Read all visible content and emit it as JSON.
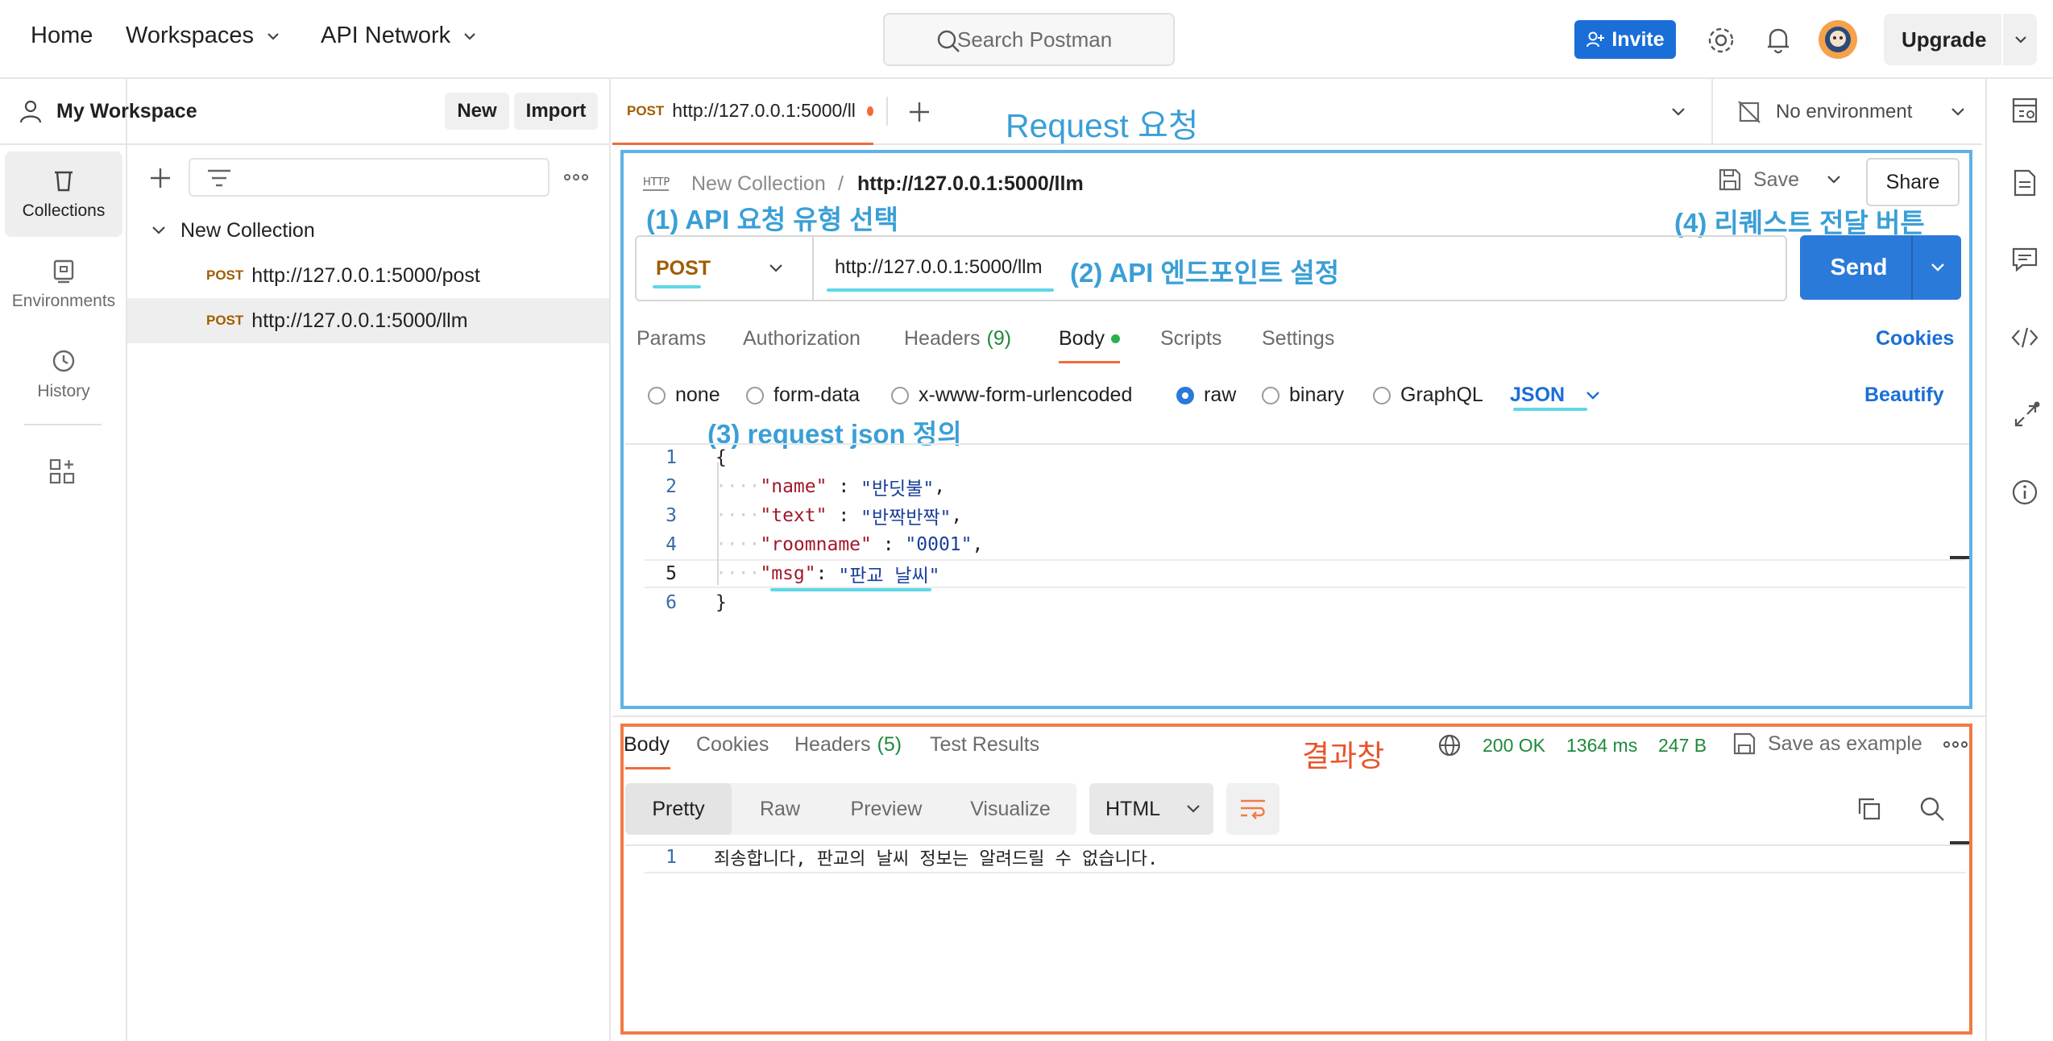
{
  "topbar": {
    "home": "Home",
    "workspaces": "Workspaces",
    "api_network": "API Network",
    "search_placeholder": "Search Postman",
    "invite": "Invite",
    "upgrade": "Upgrade"
  },
  "rail": {
    "collections": "Collections",
    "environments": "Environments",
    "history": "History"
  },
  "sidebar": {
    "workspace_name": "My Workspace",
    "new_button": "New",
    "import_button": "Import",
    "collection_name": "New Collection",
    "requests": [
      {
        "method": "POST",
        "url": "http://127.0.0.1:5000/post"
      },
      {
        "method": "POST",
        "url": "http://127.0.0.1:5000/llm"
      }
    ]
  },
  "tab": {
    "method": "POST",
    "title": "http://127.0.0.1:5000/ll"
  },
  "environment": "No environment",
  "request": {
    "breadcrumb_collection": "New Collection",
    "breadcrumb_sep": "/",
    "breadcrumb_request": "http://127.0.0.1:5000/llm",
    "save": "Save",
    "share": "Share",
    "method": "POST",
    "url": "http://127.0.0.1:5000/llm",
    "send": "Send",
    "tabs": {
      "params": "Params",
      "authorization": "Authorization",
      "headers": "Headers",
      "headers_count": "(9)",
      "body": "Body",
      "scripts": "Scripts",
      "settings": "Settings",
      "cookies": "Cookies"
    },
    "body_types": [
      "none",
      "form-data",
      "x-www-form-urlencoded",
      "raw",
      "binary",
      "GraphQL"
    ],
    "body_format": "JSON",
    "beautify": "Beautify",
    "code": [
      {
        "no": "1",
        "text": "{"
      },
      {
        "no": "2",
        "key": "\"name\"",
        "sep": " : ",
        "val": "\"반딧불\"",
        "tail": ","
      },
      {
        "no": "3",
        "key": "\"text\"",
        "sep": " : ",
        "val": "\"반짝반짝\"",
        "tail": ","
      },
      {
        "no": "4",
        "key": "\"roomname\"",
        "sep": " : ",
        "val": "\"0001\"",
        "tail": ","
      },
      {
        "no": "5",
        "key": "\"msg\"",
        "sep": ": ",
        "val": "\"판교 날씨\"",
        "tail": ""
      },
      {
        "no": "6",
        "text": "}"
      }
    ]
  },
  "annotations": {
    "request_title": "Request 요청",
    "a1": "(1) API 요청 유형 선택",
    "a2": "(2) API 엔드포인트 설정",
    "a3": "(3) request  json 정의",
    "a4": "(4) 리퀘스트 전달 버튼",
    "result": "결과창"
  },
  "response": {
    "tabs": {
      "body": "Body",
      "cookies": "Cookies",
      "headers": "Headers",
      "headers_count": "(5)",
      "test_results": "Test Results"
    },
    "status": "200 OK",
    "time": "1364 ms",
    "size": "247 B",
    "save_example": "Save as example",
    "views": [
      "Pretty",
      "Raw",
      "Preview",
      "Visualize"
    ],
    "format": "HTML",
    "lines": [
      {
        "no": "1",
        "text": "죄송합니다, 판교의 날씨 정보는 알려드릴 수 없습니다."
      }
    ]
  },
  "colors": {
    "accent_blue": "#2a7ad9",
    "annotation_blue": "#3a9fd6",
    "annotation_orange": "#e8542a",
    "method_post": "#a15c00",
    "status_green": "#1e8a3a"
  }
}
